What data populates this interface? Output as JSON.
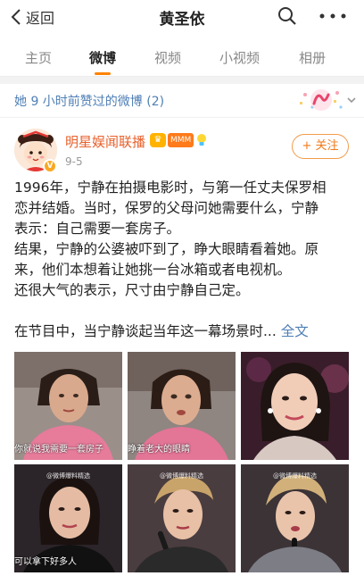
{
  "nav": {
    "back_label": "返回",
    "title": "黄圣依"
  },
  "tabs": [
    "主页",
    "微博",
    "视频",
    "小视频",
    "相册"
  ],
  "liked": {
    "text": "她 9 小时前赞过的微博 (2)"
  },
  "post": {
    "author": "明星娱闻联播",
    "date": "9-5",
    "follow_label": "+ 关注",
    "badge_vip": "MMM",
    "lines": [
      "1996年，宁静在拍摄电影时，与第一任丈夫保罗相",
      "恋并结婚。当时，保罗的父母问她需要什么，宁静",
      "表示：自己需要一套房子。",
      "结果，宁静的公婆被吓到了，睁大眼睛看着她。原",
      "来，他们本想着让她挑一台冰箱或者电视机。",
      "还很大气的表示，尺寸由宁静自己定。"
    ],
    "last_line": "在节目中，当宁静谈起当年这一幕场景时...",
    "fulltext_label": "全文"
  },
  "images": [
    {
      "caption": "你就说我需要一套房子",
      "watermark": ""
    },
    {
      "caption": "睁着老大的眼睛",
      "watermark": ""
    },
    {
      "caption": "",
      "watermark": ""
    },
    {
      "caption": "可以拿下好多人",
      "watermark": "@微博爆料精选"
    },
    {
      "caption": "",
      "watermark": "@微博爆料精选"
    },
    {
      "caption": "",
      "watermark": "@微博爆料精选"
    }
  ],
  "colors": {
    "accent": "#ff8200",
    "link": "#4f7fb5",
    "author": "#e8612c"
  }
}
